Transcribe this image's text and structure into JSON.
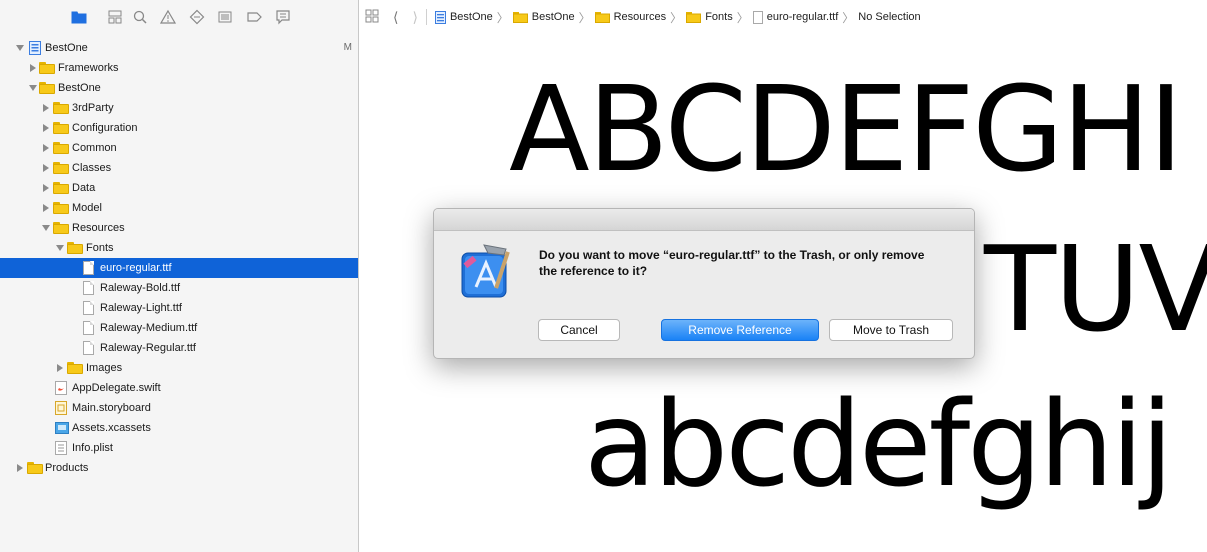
{
  "navigator": {
    "toolbar_icons": [
      "project-navigator-icon",
      "symbol-navigator-icon",
      "find-navigator-icon",
      "issue-navigator-icon",
      "test-navigator-icon",
      "debug-navigator-icon",
      "breakpoint-navigator-icon",
      "report-navigator-icon"
    ],
    "tree": [
      {
        "label": "BestOne",
        "badge": "M"
      },
      {
        "label": "Frameworks"
      },
      {
        "label": "BestOne"
      },
      {
        "label": "3rdParty"
      },
      {
        "label": "Configuration"
      },
      {
        "label": "Common"
      },
      {
        "label": "Classes"
      },
      {
        "label": "Data"
      },
      {
        "label": "Model"
      },
      {
        "label": "Resources"
      },
      {
        "label": "Fonts"
      },
      {
        "label": "euro-regular.ttf"
      },
      {
        "label": "Raleway-Bold.ttf"
      },
      {
        "label": "Raleway-Light.ttf"
      },
      {
        "label": "Raleway-Medium.ttf"
      },
      {
        "label": "Raleway-Regular.ttf"
      },
      {
        "label": "Images"
      },
      {
        "label": "AppDelegate.swift"
      },
      {
        "label": "Main.storyboard"
      },
      {
        "label": "Assets.xcassets"
      },
      {
        "label": "Info.plist"
      },
      {
        "label": "Products"
      }
    ]
  },
  "jumpbar": {
    "crumbs": [
      "BestOne",
      "BestOne",
      "Resources",
      "Fonts",
      "euro-regular.ttf",
      "No Selection"
    ]
  },
  "preview": {
    "line1": "ABCDEFGHI",
    "line2": "TUV",
    "line3": "abcdefghij"
  },
  "dialog": {
    "message": "Do you want to move “euro-regular.ttf” to the Trash, or only remove the reference to it?",
    "buttons": {
      "cancel": "Cancel",
      "remove": "Remove Reference",
      "trash": "Move to Trash"
    }
  },
  "colors": {
    "selection": "#0f63d8",
    "folder": "#f7c919",
    "primary_button": "#1a82f6"
  }
}
